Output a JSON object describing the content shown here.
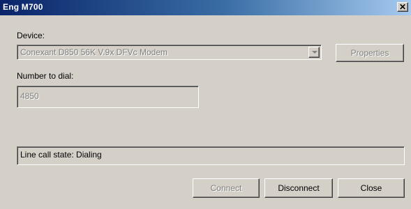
{
  "window": {
    "title": "Eng M700",
    "close_glyph": "✕"
  },
  "device": {
    "label": "Device:",
    "value": "Conexant D850 56K V.9x DFVc Modem",
    "properties_label": "Properties"
  },
  "number": {
    "label": "Number to dial:",
    "value": "4850"
  },
  "status": {
    "text": "Line call state: Dialing"
  },
  "buttons": {
    "connect": "Connect",
    "disconnect": "Disconnect",
    "close": "Close"
  },
  "colors": {
    "face": "#d4d0c8",
    "title_start": "#0a246a",
    "title_end": "#a6caf0",
    "disabled_text": "#808080"
  },
  "icons": {
    "close": "close-icon",
    "dropdown": "chevron-down-icon"
  }
}
